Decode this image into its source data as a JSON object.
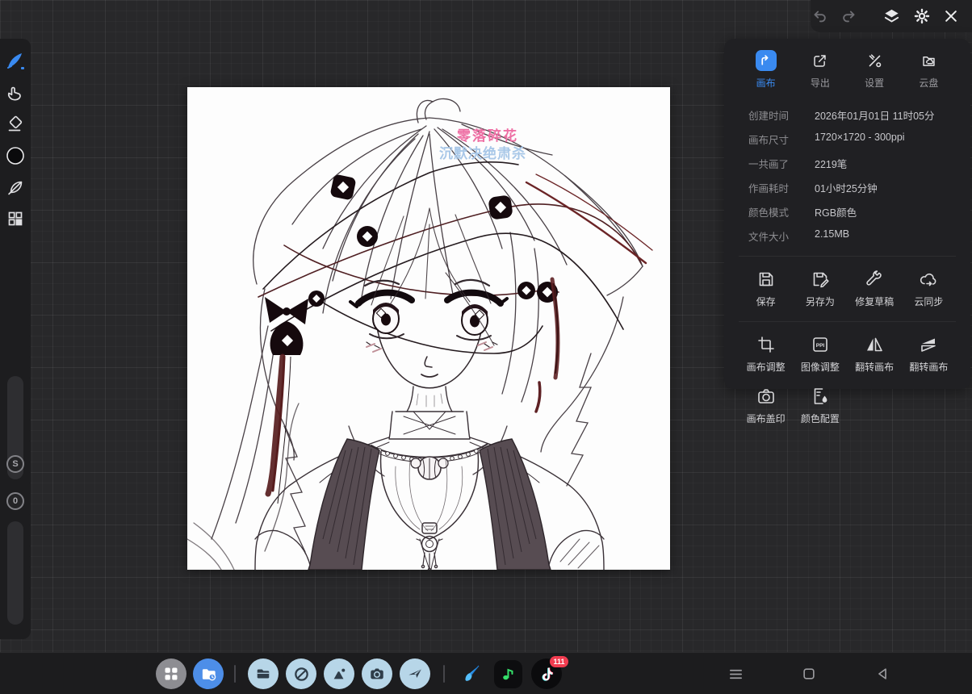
{
  "colors": {
    "accent_blue": "#3a8af0",
    "background": "#28282a",
    "panel": "#202023",
    "badge_red": "#f23c50",
    "watermark_pink": "#ee6fa4",
    "watermark_blue": "#a9c8e8"
  },
  "top_toolbar": {
    "icons": [
      "undo",
      "redo",
      "layers",
      "settings",
      "close"
    ]
  },
  "left_toolbar": {
    "tools": [
      "brush",
      "smudge-finger",
      "eraser",
      "color-swatch-black",
      "leaf-brush",
      "materials-grid"
    ],
    "sliders": [
      {
        "label": "S"
      },
      {
        "label": "0"
      }
    ]
  },
  "canvas": {
    "watermark_line1": "零落碎花",
    "watermark_line2": "沉默决绝肃杀"
  },
  "right_panel": {
    "tabs": [
      {
        "label": "画布",
        "icon": "canvas-tab-icon",
        "active": true
      },
      {
        "label": "导出",
        "icon": "export-tab-icon",
        "active": false
      },
      {
        "label": "设置",
        "icon": "settings-tab-icon",
        "active": false
      },
      {
        "label": "云盘",
        "icon": "cloud-disk-tab-icon",
        "active": false
      }
    ],
    "info": [
      {
        "label": "创建时间",
        "value": "2026年01月01日 11时05分"
      },
      {
        "label": "画布尺寸",
        "value": "1720×1720 - 300ppi"
      },
      {
        "label": "一共画了",
        "value": "2219笔"
      },
      {
        "label": "作画耗时",
        "value": "01小时25分钟"
      },
      {
        "label": "颜色模式",
        "value": "RGB颜色"
      },
      {
        "label": "文件大小",
        "value": "2.15MB"
      }
    ],
    "actions_row1": [
      {
        "label": "保存",
        "icon": "floppy-icon"
      },
      {
        "label": "另存为",
        "icon": "floppy-edit-icon"
      },
      {
        "label": "修复草稿",
        "icon": "wrench-icon"
      },
      {
        "label": "云同步",
        "icon": "cloud-sync-icon"
      }
    ],
    "actions_row2": [
      {
        "label": "画布调整",
        "icon": "crop-icon"
      },
      {
        "label": "图像调整",
        "icon": "ppi-box-icon"
      },
      {
        "label": "翻转画布",
        "icon": "flip-horizontal-icon"
      },
      {
        "label": "翻转画布",
        "icon": "flip-canvas-icon"
      }
    ],
    "actions_row3": [
      {
        "label": "画布盖印",
        "icon": "camera-icon"
      },
      {
        "label": "颜色配置",
        "icon": "color-profile-icon"
      }
    ],
    "ppi_icon_text": "PPI"
  },
  "taskbar": {
    "launcher": [
      "app-drawer",
      "recent-files-folder"
    ],
    "apps": [
      "files-app",
      "browser-app",
      "gallery-app",
      "camera-app",
      "mail-app"
    ],
    "pinned": [
      {
        "icon": "paint-app"
      },
      {
        "icon": "music-app"
      },
      {
        "icon": "douyin-app",
        "badge": "111"
      }
    ],
    "nav": [
      "menu",
      "home-square",
      "back-triangle"
    ]
  }
}
